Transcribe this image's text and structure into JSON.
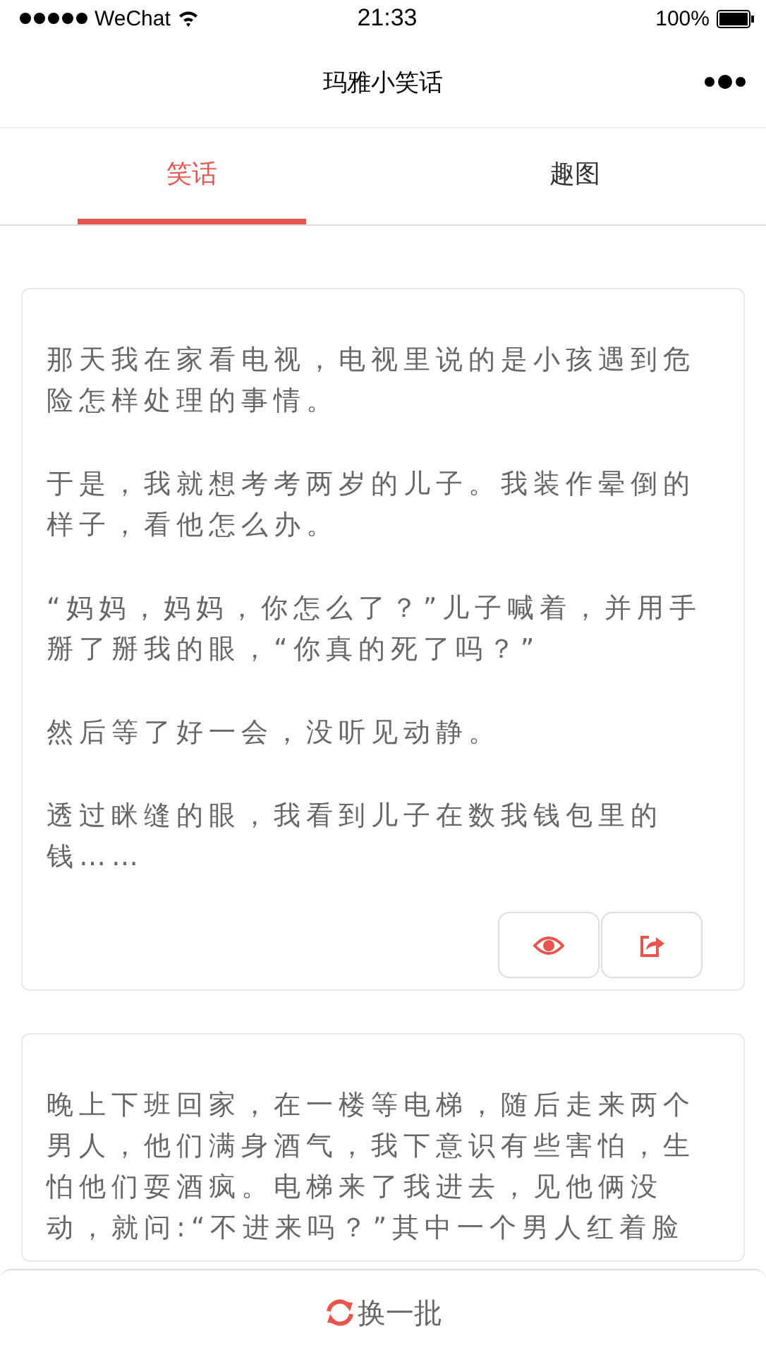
{
  "status_bar": {
    "carrier": "WeChat",
    "time": "21:33",
    "battery": "100%"
  },
  "nav_bar": {
    "title": "玛雅小笑话"
  },
  "tabs": [
    {
      "label": "笑话",
      "selected": true
    },
    {
      "label": "趣图",
      "selected": false
    }
  ],
  "jokes": [
    {
      "paragraphs": [
        "那天我在家看电视，电视里说的是小孩遇到危险怎样处理的事情。",
        "于是，我就想考考两岁的儿子。我装作晕倒的样子，看他怎么办。",
        "“妈妈，妈妈，你怎么了？”儿子喊着，并用手掰了掰我的眼，“你真的死了吗？”",
        "然后等了好一会，没听见动静。",
        "透过眯缝的眼，我看到儿子在数我钱包里的钱……"
      ],
      "actions": true
    },
    {
      "paragraphs": [
        "晚上下班回家，在一楼等电梯，随后走来两个男人，他们满身酒气，我下意识有些害怕，生怕他们耍酒疯。电梯来了我进去，见他俩没动，就问:“不进来吗？”其中一个男人红着脸"
      ],
      "actions": false
    }
  ],
  "footer": {
    "button": "换一批"
  }
}
